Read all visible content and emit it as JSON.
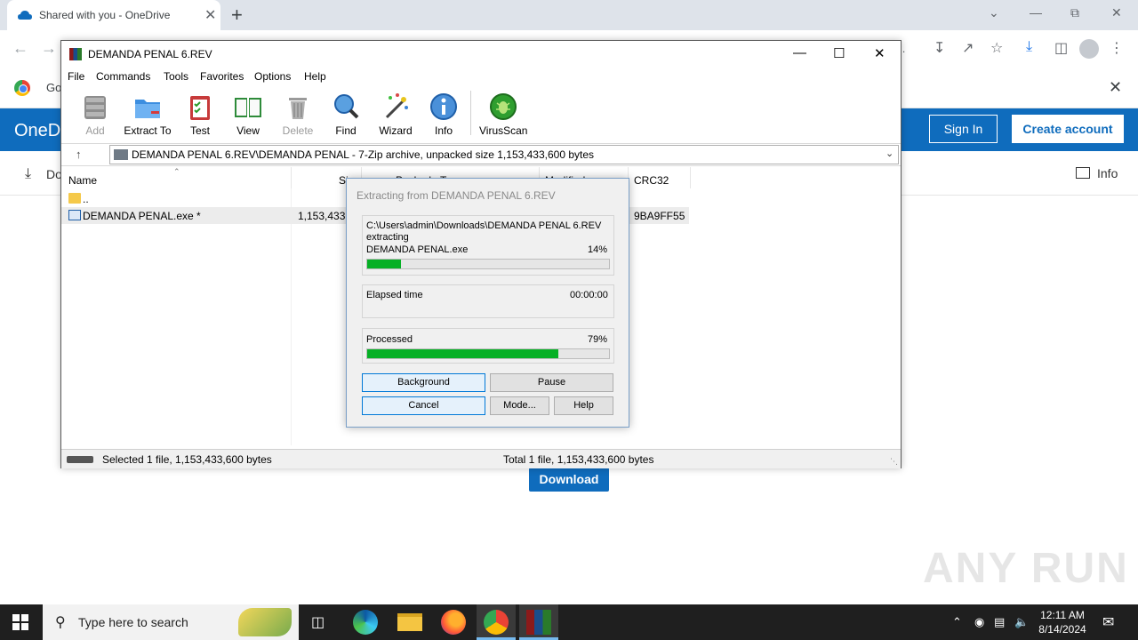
{
  "browser": {
    "tab_title": "Shared with you - OneDrive",
    "tab_close": "✕",
    "new_tab": "+",
    "address_fragment": "y...",
    "bookmark_fragment": "Go",
    "bookmark_close": "✕"
  },
  "onedrive": {
    "logo_fragment": "OneD",
    "sign_in": "Sign In",
    "create_account": "Create account",
    "download_fragment": "Do",
    "info_label": "Info",
    "download_button": "Download"
  },
  "winrar": {
    "title": "DEMANDA PENAL 6.REV",
    "menu": [
      "File",
      "Commands",
      "Tools",
      "Favorites",
      "Options",
      "Help"
    ],
    "toolbar": [
      {
        "label": "Add",
        "icon": "add-archive-icon",
        "enabled": false
      },
      {
        "label": "Extract To",
        "icon": "extract-folder-icon",
        "enabled": true
      },
      {
        "label": "Test",
        "icon": "test-clipboard-icon",
        "enabled": true
      },
      {
        "label": "View",
        "icon": "view-book-icon",
        "enabled": true
      },
      {
        "label": "Delete",
        "icon": "trash-icon",
        "enabled": false
      },
      {
        "label": "Find",
        "icon": "magnifier-icon",
        "enabled": true
      },
      {
        "label": "Wizard",
        "icon": "wand-icon",
        "enabled": true
      },
      {
        "label": "Info",
        "icon": "info-icon",
        "enabled": true
      },
      {
        "label": "VirusScan",
        "icon": "virus-bug-icon",
        "enabled": true
      }
    ],
    "path": "DEMANDA PENAL 6.REV\\DEMANDA PENAL - 7-Zip archive, unpacked size 1,153,433,600 bytes",
    "columns": [
      "Name",
      "Si",
      "Packed",
      "T",
      "Modified",
      "CRC32"
    ],
    "rows": [
      {
        "name": "..",
        "size": "",
        "crc": ""
      },
      {
        "name": "DEMANDA PENAL.exe *",
        "size": "1,153,433,6",
        "crc": "9BA9FF55"
      }
    ],
    "status_left": "Selected 1 file, 1,153,433,600 bytes",
    "status_right": "Total 1 file, 1,153,433,600 bytes"
  },
  "dialog": {
    "title": "Extracting from DEMANDA PENAL 6.REV",
    "archive_path": "C:\\Users\\admin\\Downloads\\DEMANDA PENAL 6.REV",
    "action": "extracting",
    "current_file": "DEMANDA PENAL.exe",
    "file_percent_label": "14%",
    "file_progress": 0.14,
    "elapsed_label": "Elapsed time",
    "elapsed_value": "00:00:00",
    "processed_label": "Processed",
    "processed_percent_label": "79%",
    "processed_progress": 0.79,
    "buttons": {
      "background": "Background",
      "pause": "Pause",
      "cancel": "Cancel",
      "mode": "Mode...",
      "help": "Help"
    }
  },
  "taskbar": {
    "search_placeholder": "Type here to search",
    "time": "12:11 AM",
    "date": "8/14/2024"
  },
  "watermark": "ANY RUN",
  "colors": {
    "onedrive_blue": "#0f6cbd",
    "progress_green": "#06b025",
    "taskbar": "#1f1f1f"
  }
}
